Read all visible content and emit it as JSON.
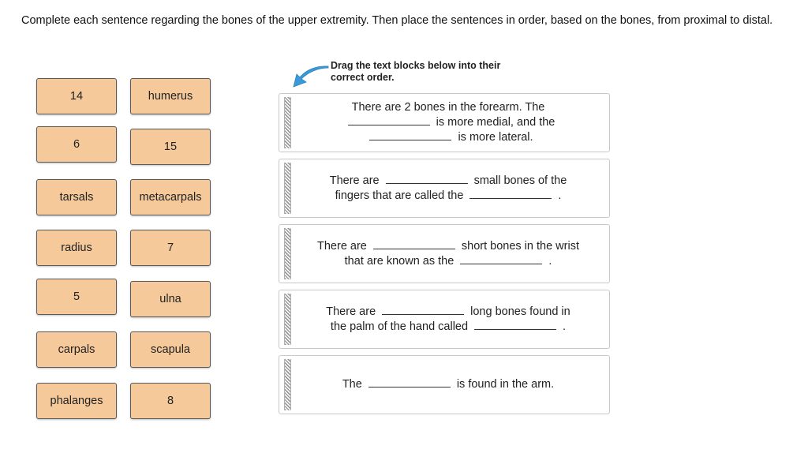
{
  "instructions": "Complete each sentence regarding the bones of the upper extremity. Then place the sentences in order, based on the bones, from proximal to distal.",
  "hint": {
    "text_line1": "Drag the text blocks below into their",
    "text_line2": "correct order.",
    "icon": "arrow-icon",
    "arrow_color": "#3a9ad9"
  },
  "word_bank": {
    "tiles": [
      "14",
      "humerus",
      "6",
      "15",
      "tarsals",
      "metacarpals",
      "radius",
      "7",
      "5",
      "ulna",
      "carpals",
      "scapula",
      "phalanges",
      "8"
    ],
    "tile_color": "#f5c99a"
  },
  "blocks": [
    {
      "l1a": "There are 2 bones in the forearm. The",
      "l2b": "is more medial, and the",
      "l3b": "is more lateral."
    },
    {
      "l1a": "There are",
      "l1b": "small bones of the",
      "l2a": "fingers that are called the",
      "l2b": "."
    },
    {
      "l1a": "There are",
      "l1b": "short bones in the wrist",
      "l2a": "that are known as the",
      "l2b": "."
    },
    {
      "l1a": "There are",
      "l1b": "long bones found in",
      "l2a": "the palm of the hand called",
      "l2b": "."
    },
    {
      "l1a": "The",
      "l1b": "is found in the arm."
    }
  ]
}
